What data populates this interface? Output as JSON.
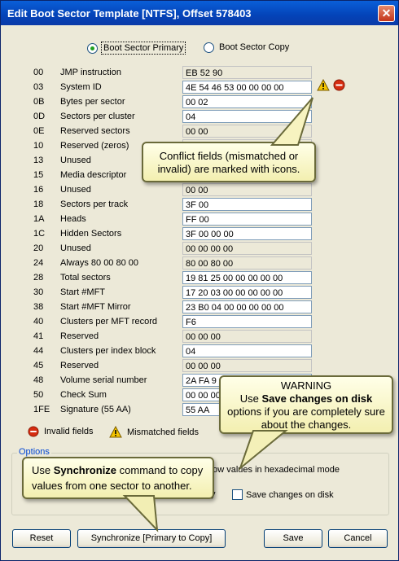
{
  "window": {
    "title": "Edit Boot Sector Template [NTFS], Offset 578403"
  },
  "radios": {
    "primary": "Boot Sector Primary",
    "copy": "Boot Sector Copy"
  },
  "fields": [
    {
      "offset": "00",
      "name": "JMP instruction",
      "value": "EB 52 90",
      "readonly": true
    },
    {
      "offset": "03",
      "name": "System ID",
      "value": "4E 54 46 53 00 00 00 00",
      "readonly": false
    },
    {
      "offset": "0B",
      "name": "Bytes per sector",
      "value": "00 02",
      "readonly": false
    },
    {
      "offset": "0D",
      "name": "Sectors per cluster",
      "value": "04",
      "readonly": false
    },
    {
      "offset": "0E",
      "name": "Reserved sectors",
      "value": "00 00",
      "readonly": true
    },
    {
      "offset": "10",
      "name": "Reserved (zeros)",
      "value": "",
      "readonly": true
    },
    {
      "offset": "13",
      "name": "Unused",
      "value": "",
      "readonly": true
    },
    {
      "offset": "15",
      "name": "Media descriptor",
      "value": "",
      "readonly": false
    },
    {
      "offset": "16",
      "name": "Unused",
      "value": "00 00",
      "readonly": true
    },
    {
      "offset": "18",
      "name": "Sectors per track",
      "value": "3F 00",
      "readonly": false
    },
    {
      "offset": "1A",
      "name": "Heads",
      "value": "FF 00",
      "readonly": false
    },
    {
      "offset": "1C",
      "name": "Hidden Sectors",
      "value": "3F 00 00 00",
      "readonly": false
    },
    {
      "offset": "20",
      "name": "Unused",
      "value": "00 00 00 00",
      "readonly": true
    },
    {
      "offset": "24",
      "name": "Always 80 00 80 00",
      "value": "80 00 80 00",
      "readonly": true
    },
    {
      "offset": "28",
      "name": "Total sectors",
      "value": "19 81 25 00 00 00 00 00",
      "readonly": false
    },
    {
      "offset": "30",
      "name": "Start #MFT",
      "value": "17 20 03 00 00 00 00 00",
      "readonly": false
    },
    {
      "offset": "38",
      "name": "Start #MFT Mirror",
      "value": "23 B0 04 00 00 00 00 00",
      "readonly": false
    },
    {
      "offset": "40",
      "name": "Clusters per MFT record",
      "value": "F6",
      "readonly": false
    },
    {
      "offset": "41",
      "name": "Reserved",
      "value": "00 00 00",
      "readonly": true
    },
    {
      "offset": "44",
      "name": "Clusters per index block",
      "value": "04",
      "readonly": false
    },
    {
      "offset": "45",
      "name": "Reserved",
      "value": "00 00 00",
      "readonly": true
    },
    {
      "offset": "48",
      "name": "Volume serial number",
      "value": "2A FA 9",
      "readonly": false
    },
    {
      "offset": "50",
      "name": "Check Sum",
      "value": "00 00 00",
      "readonly": false
    },
    {
      "offset": "1FE",
      "name": "Signature (55 AA)",
      "value": "55 AA",
      "readonly": false
    }
  ],
  "legend": {
    "invalid": "Invalid fields",
    "mismatched": "Mismatched fields"
  },
  "options": {
    "title": "Options",
    "hex_mode": "how values in hexadecimal mode",
    "sync_partial": "y",
    "save_changes": "Save changes on disk"
  },
  "buttons": {
    "reset": "Reset",
    "synchronize": "Synchronize [Primary to Copy]",
    "save": "Save",
    "cancel": "Cancel"
  },
  "callouts": {
    "conflict": "Conflict fields (mismatched or invalid) are marked with icons.",
    "warning_title": "WARNING",
    "warning_use": "Use ",
    "warning_bold": "Save changes on disk",
    "warning_rest": "options if you are completely sure about the changes.",
    "sync_use": "Use ",
    "sync_bold": "Synchronize",
    "sync_rest": " command to copy values from one sector to another."
  },
  "icons": {
    "warning": "warning-icon",
    "error": "error-icon",
    "close": "close-icon"
  },
  "colors": {
    "title_bar": "#0443b8",
    "error": "#d52c10",
    "warning": "#f4c400",
    "callout_bg": "#ffffe1"
  }
}
